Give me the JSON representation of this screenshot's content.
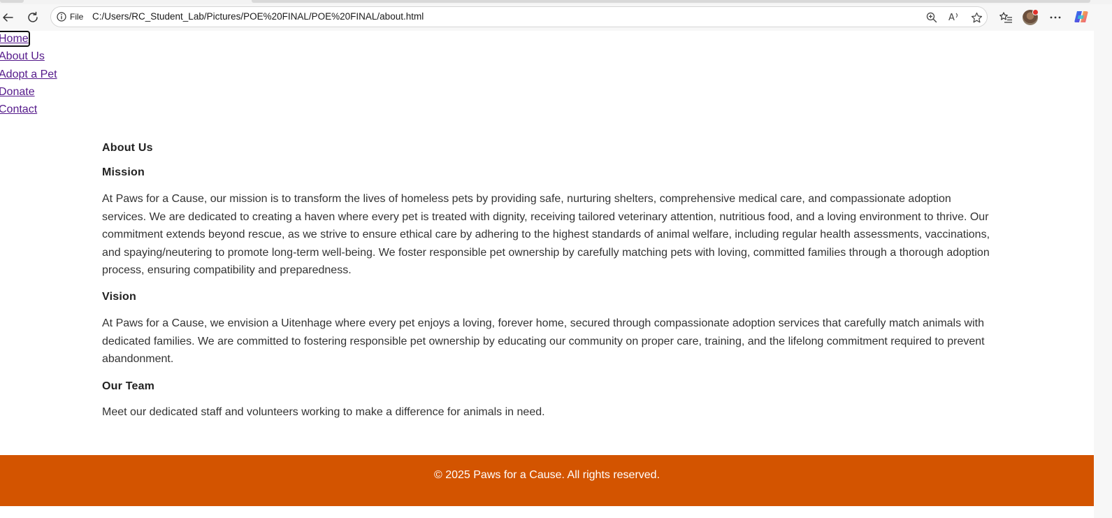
{
  "browser": {
    "scheme_label": "File",
    "url": "C:/Users/RC_Student_Lab/Pictures/POE%20FINAL/POE%20FINAL/about.html",
    "icons": [
      "back-arrow-icon",
      "refresh-icon",
      "info-icon",
      "zoom-icon",
      "read-aloud-icon",
      "favorite-star-icon",
      "favorites-list-icon",
      "profile-avatar",
      "more-menu-icon",
      "copilot-icon"
    ],
    "read_aloud_glyph": "A"
  },
  "nav": {
    "items": [
      {
        "label": "Home"
      },
      {
        "label": "About Us"
      },
      {
        "label": "Adopt a Pet"
      },
      {
        "label": "Donate"
      },
      {
        "label": "Contact"
      }
    ]
  },
  "content": {
    "page_heading": "About Us",
    "mission": {
      "heading": "Mission",
      "text": "At Paws for a Cause, our mission is to transform the lives of homeless pets by providing safe, nurturing shelters, comprehensive medical care, and compassionate adoption services. We are dedicated to creating a haven where every pet is treated with dignity, receiving tailored veterinary attention, nutritious food, and a loving environment to thrive. Our commitment extends beyond rescue, as we strive to ensure ethical care by adhering to the highest standards of animal welfare, including regular health assessments, vaccinations, and spaying/neutering to promote long-term well-being. We foster responsible pet ownership by carefully matching pets with loving, committed families through a thorough adoption process, ensuring compatibility and preparedness."
    },
    "vision": {
      "heading": "Vision",
      "text": "At Paws for a Cause, we envision a Uitenhage where every pet enjoys a loving, forever home, secured through compassionate adoption services that carefully match animals with dedicated families. We are committed to fostering responsible pet ownership by educating our community on proper care, training, and the lifelong commitment required to prevent abandonment."
    },
    "team": {
      "heading": "Our Team",
      "text": "Meet our dedicated staff and volunteers working to make a difference for animals in need."
    }
  },
  "footer": {
    "text": "© 2025 Paws for a Cause. All rights reserved."
  },
  "colors": {
    "footer_bg": "#d35400",
    "link_visited": "#551a8b",
    "body_text": "#333333"
  }
}
